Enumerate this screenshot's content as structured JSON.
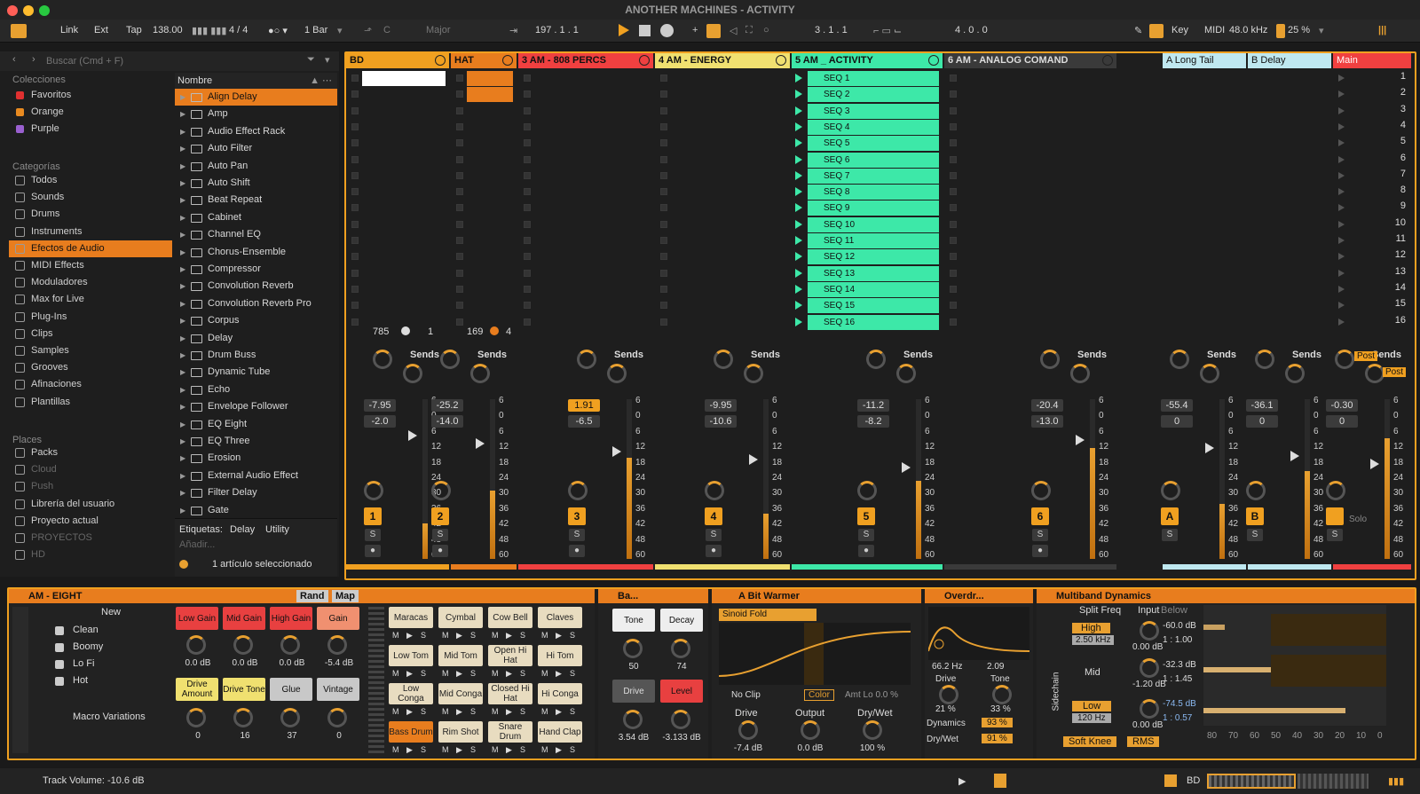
{
  "window": {
    "title": "ANOTHER MACHINES - ACTIVITY"
  },
  "transport": {
    "link": "Link",
    "ext": "Ext",
    "tap": "Tap",
    "tempo": "138.00",
    "time_sig": "4 / 4",
    "quantize": "1 Bar",
    "key": "C",
    "scale": "Major",
    "position": "197 .  1 .  1",
    "loop_start": "3 .  1 .  1",
    "loop_length": "4 .  0 .  0",
    "key_map": "Key",
    "midi_map": "MIDI",
    "sample_rate": "48.0 kHz",
    "cpu": "25 %"
  },
  "browser": {
    "search_placeholder": "Buscar (Cmd + F)",
    "list_header": "Nombre",
    "collections_title": "Colecciones",
    "collections": [
      {
        "label": "Favoritos",
        "color": "#e03030"
      },
      {
        "label": "Orange",
        "color": "#e88a20"
      },
      {
        "label": "Purple",
        "color": "#9a60d0"
      }
    ],
    "categories_title": "Categorías",
    "categories": [
      "Todos",
      "Sounds",
      "Drums",
      "Instruments",
      "Efectos de Audio",
      "MIDI Effects",
      "Moduladores",
      "Max for Live",
      "Plug-Ins",
      "Clips",
      "Samples",
      "Grooves",
      "Afinaciones",
      "Plantillas"
    ],
    "places_title": "Places",
    "places": [
      "Packs",
      "Cloud",
      "Push",
      "Librería del usuario",
      "Proyecto actual",
      "PROYECTOS",
      "HD"
    ],
    "items": [
      "Align Delay",
      "Amp",
      "Audio Effect Rack",
      "Auto Filter",
      "Auto Pan",
      "Auto Shift",
      "Beat Repeat",
      "Cabinet",
      "Channel EQ",
      "Chorus-Ensemble",
      "Compressor",
      "Convolution Reverb",
      "Convolution Reverb Pro",
      "Corpus",
      "Delay",
      "Drum Buss",
      "Dynamic Tube",
      "Echo",
      "Envelope Follower",
      "EQ Eight",
      "EQ Three",
      "Erosion",
      "External Audio Effect",
      "Filter Delay",
      "Gate"
    ],
    "tags_label": "Etiquetas:",
    "tags": [
      "Delay",
      "Utility"
    ],
    "add_label": "Añadir...",
    "selected_count": "1 artículo seleccionado"
  },
  "tracks": [
    {
      "name": "BD",
      "color": "#f0a020",
      "num": "1",
      "vol": "-7.95",
      "pan": "-2.0"
    },
    {
      "name": "HAT",
      "color": "#e87d1e",
      "num": "2",
      "vol": "-25.2",
      "pan": "-14.0"
    },
    {
      "name": "3 AM - 808 PERCS",
      "color": "#f04040",
      "num": "3",
      "vol": "1.91",
      "pan": "-6.5"
    },
    {
      "name": "4 AM - ENERGY",
      "color": "#f0e070",
      "num": "4",
      "vol": "-9.95",
      "pan": "-10.6"
    },
    {
      "name": "5 AM _ ACTIVITY",
      "color": "#3de8a8",
      "num": "5",
      "vol": "-11.2",
      "pan": "-8.2"
    },
    {
      "name": "6 AM - ANALOG COMAND",
      "color": "#3a3a3a",
      "num": "6",
      "vol": "-20.4",
      "pan": "-13.0"
    }
  ],
  "returns": [
    {
      "name": "A Long Tail",
      "num": "A",
      "vol": "-55.4",
      "pan": "0"
    },
    {
      "name": "B Delay",
      "num": "B",
      "vol": "-36.1",
      "pan": "0"
    }
  ],
  "main": {
    "name": "Main",
    "vol": "-0.30",
    "pan": "0",
    "post": "Post",
    "solo": "Solo"
  },
  "seq_clips": [
    "SEQ 1",
    "SEQ 2",
    "SEQ 3",
    "SEQ 4",
    "SEQ 5",
    "SEQ 6",
    "SEQ 7",
    "SEQ 8",
    "SEQ 9",
    "SEQ 10",
    "SEQ 11",
    "SEQ 12",
    "SEQ 13",
    "SEQ 14",
    "SEQ 15",
    "SEQ 16"
  ],
  "scenes": [
    "1",
    "2",
    "3",
    "4",
    "5",
    "6",
    "7",
    "8",
    "9",
    "10",
    "11",
    "12",
    "13",
    "14",
    "15",
    "16"
  ],
  "track_io": {
    "bd_a": "785",
    "bd_b": "1",
    "hat_a": "169",
    "hat_b": "4"
  },
  "sends_label": "Sends",
  "meter_scale": [
    "6",
    "0",
    "6",
    "12",
    "18",
    "24",
    "30",
    "36",
    "42",
    "48",
    "60"
  ],
  "drumrack": {
    "name": "AM - EIGHT",
    "rand": "Rand",
    "map": "Map",
    "new": "New",
    "presets": [
      "Clean",
      "Boomy",
      "Lo Fi",
      "Hot"
    ],
    "macro_variations": "Macro Variations",
    "macros_top": [
      {
        "label": "Low Gain",
        "val": "0.0 dB",
        "color": "#e84040"
      },
      {
        "label": "Mid Gain",
        "val": "0.0 dB",
        "color": "#e84040"
      },
      {
        "label": "High Gain",
        "val": "0.0 dB",
        "color": "#e84040"
      },
      {
        "label": "Gain",
        "val": "-5.4 dB",
        "color": "#f09070"
      }
    ],
    "macros_bot": [
      {
        "label": "Drive Amount",
        "val": "0",
        "color": "#f0e070"
      },
      {
        "label": "Drive Tone",
        "val": "16",
        "color": "#f0e070"
      },
      {
        "label": "Glue",
        "val": "37",
        "color": "#c8c8c8"
      },
      {
        "label": "Vintage",
        "val": "0",
        "color": "#c8c8c8"
      }
    ],
    "pads": [
      "Maracas",
      "Cymbal",
      "Cow Bell",
      "Claves",
      "Low Tom",
      "Mid Tom",
      "Open Hi Hat",
      "Hi Tom",
      "Low Conga",
      "Mid Conga",
      "Closed Hi Hat",
      "Hi Conga",
      "Bass Drum",
      "Rim Shot",
      "Snare Drum",
      "Hand Clap"
    ]
  },
  "bass_dev": {
    "name": "Ba...",
    "tone": "Tone",
    "decay": "Decay",
    "tone_val": "50",
    "decay_val": "74",
    "drive": "Drive",
    "level": "Level",
    "drive_val": "3.54 dB",
    "level_val": "-3.133 dB"
  },
  "warmer": {
    "name": "A Bit Warmer",
    "mode": "Sinoid Fold",
    "clip": "No Clip",
    "color_btn": "Color",
    "amt": "Amt Lo  0.0 %",
    "drive": "Drive",
    "output": "Output",
    "drywet": "Dry/Wet",
    "drive_val": "-7.4 dB",
    "output_val": "0.0 dB",
    "drywet_val": "100 %"
  },
  "overdrive": {
    "name": "Overdr...",
    "freq": "66.2 Hz",
    "bw": "2.09",
    "drive": "Drive",
    "tone": "Tone",
    "drive_val": "21 %",
    "tone_val": "33 %",
    "dynamics": "Dynamics",
    "dynamics_val": "93 %",
    "drywet": "Dry/Wet",
    "drywet_val": "91 %"
  },
  "multiband": {
    "name": "Multiband Dynamics",
    "split": "Split Freq",
    "input": "Input",
    "high": "High",
    "high_freq": "2.50 kHz",
    "mid": "Mid",
    "low": "Low",
    "low_freq": "120 Hz",
    "in_high": "0.00 dB",
    "in_mid": "-1.20 dB",
    "in_low": "0.00 dB",
    "below": "Below",
    "below_vals": [
      "-60.0 dB",
      "1 : 1.00",
      "-32.3 dB",
      "1 : 1.45",
      "-74.5 dB",
      "1 : 0.57"
    ],
    "axis": [
      "80",
      "70",
      "60",
      "50",
      "40",
      "30",
      "20",
      "10",
      "0"
    ],
    "soft_knee": "Soft Knee",
    "rms": "RMS",
    "sidechain": "Sidechain"
  },
  "status": {
    "text": "Track Volume: -10.6 dB",
    "track": "BD"
  }
}
